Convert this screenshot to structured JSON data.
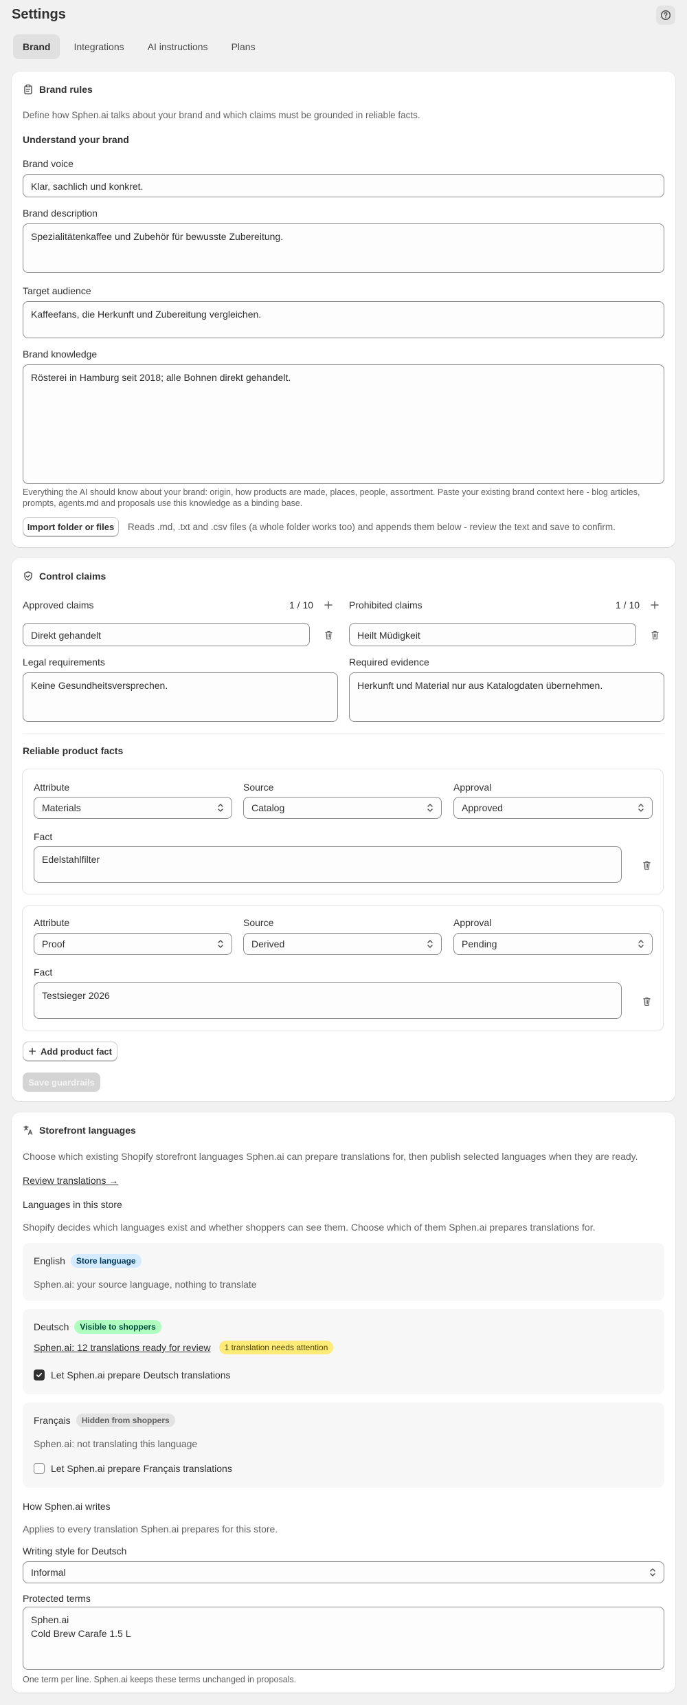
{
  "header": {
    "title": "Settings",
    "help_icon": "help-circle-icon"
  },
  "tabs": [
    {
      "label": "Brand",
      "active": true
    },
    {
      "label": "Integrations",
      "active": false
    },
    {
      "label": "AI instructions",
      "active": false
    },
    {
      "label": "Plans",
      "active": false
    }
  ],
  "brand_rules": {
    "title": "Brand rules",
    "intro": "Define how Sphen.ai talks about your brand and which claims must be grounded in reliable facts.",
    "understand_heading": "Understand your brand",
    "voice": {
      "label": "Brand voice",
      "value": "Klar, sachlich und konkret."
    },
    "description": {
      "label": "Brand description",
      "value": "Spezialitätenkaffee und Zubehör für bewusste Zubereitung."
    },
    "audience": {
      "label": "Target audience",
      "value": "Kaffeefans, die Herkunft und Zubereitung vergleichen."
    },
    "knowledge": {
      "label": "Brand knowledge",
      "value": "Rösterei in Hamburg seit 2018; alle Bohnen direkt gehandelt.",
      "help_line1": "Everything the AI should know about your brand: origin, how products are made, places, people, assortment. Paste your existing brand context here - blog articles,",
      "help_line2": "prompts, agents.md and proposals use this knowledge as a binding base."
    },
    "import_button": "Import folder or files",
    "import_help": "Reads .md, .txt and .csv files (a whole folder works too) and appends them below - review the text and save to confirm."
  },
  "control_claims": {
    "title": "Control claims",
    "approved": {
      "label": "Approved claims",
      "count": "1 / 10",
      "value": "Direkt gehandelt"
    },
    "prohibited": {
      "label": "Prohibited claims",
      "count": "1 / 10",
      "value": "Heilt Müdigkeit"
    },
    "legal": {
      "label": "Legal requirements",
      "value": "Keine Gesundheitsversprechen."
    },
    "evidence": {
      "label": "Required evidence",
      "value": "Herkunft und Material nur aus Katalogdaten übernehmen."
    },
    "facts_heading": "Reliable product facts",
    "facts_labels": {
      "attribute": "Attribute",
      "source": "Source",
      "approval": "Approval",
      "fact": "Fact"
    },
    "facts": [
      {
        "attribute": "Materials",
        "source": "Catalog",
        "approval": "Approved",
        "fact": "Edelstahlfilter"
      },
      {
        "attribute": "Proof",
        "source": "Derived",
        "approval": "Pending",
        "fact": "Testsieger 2026"
      }
    ],
    "add_fact_button": "Add product fact",
    "save_button": "Save guardrails"
  },
  "languages": {
    "title": "Storefront languages",
    "intro": "Choose which existing Shopify storefront languages Sphen.ai can prepare translations for, then publish selected languages when they are ready.",
    "review_link": "Review translations →",
    "in_store_heading": "Languages in this store",
    "in_store_help": "Shopify decides which languages exist and whether shoppers can see them. Choose which of them Sphen.ai prepares translations for.",
    "english": {
      "name": "English",
      "badge": "Store language",
      "status": "Sphen.ai: your source language, nothing to translate"
    },
    "deutsch": {
      "name": "Deutsch",
      "badge": "Visible to shoppers",
      "status_link": "Sphen.ai: 12 translations ready for review",
      "attention_badge": "1 translation needs attention",
      "checkbox_label": "Let Sphen.ai prepare Deutsch translations",
      "checked": true
    },
    "francais": {
      "name": "Français",
      "badge": "Hidden from shoppers",
      "status": "Sphen.ai: not translating this language",
      "checkbox_label": "Let Sphen.ai prepare Français translations",
      "checked": false
    },
    "writes_heading": "How Sphen.ai writes",
    "writes_help": "Applies to every translation Sphen.ai prepares for this store.",
    "style": {
      "label": "Writing style for Deutsch",
      "value": "Informal"
    },
    "protected": {
      "label": "Protected terms",
      "line1": "Sphen.ai",
      "line2": "Cold Brew Carafe 1.5 L",
      "help": "One term per line. Sphen.ai keeps these terms unchanged in proposals."
    }
  },
  "colors": {
    "badge_store_bg": "#d5ebff",
    "badge_store_fg": "#003a5a",
    "badge_visible_bg": "#affebf",
    "badge_visible_fg": "#014b40",
    "badge_hidden_bg": "#e3e3e3",
    "badge_hidden_fg": "#616161",
    "badge_attention_bg": "#ffeb78",
    "badge_attention_fg": "#4f4700"
  }
}
